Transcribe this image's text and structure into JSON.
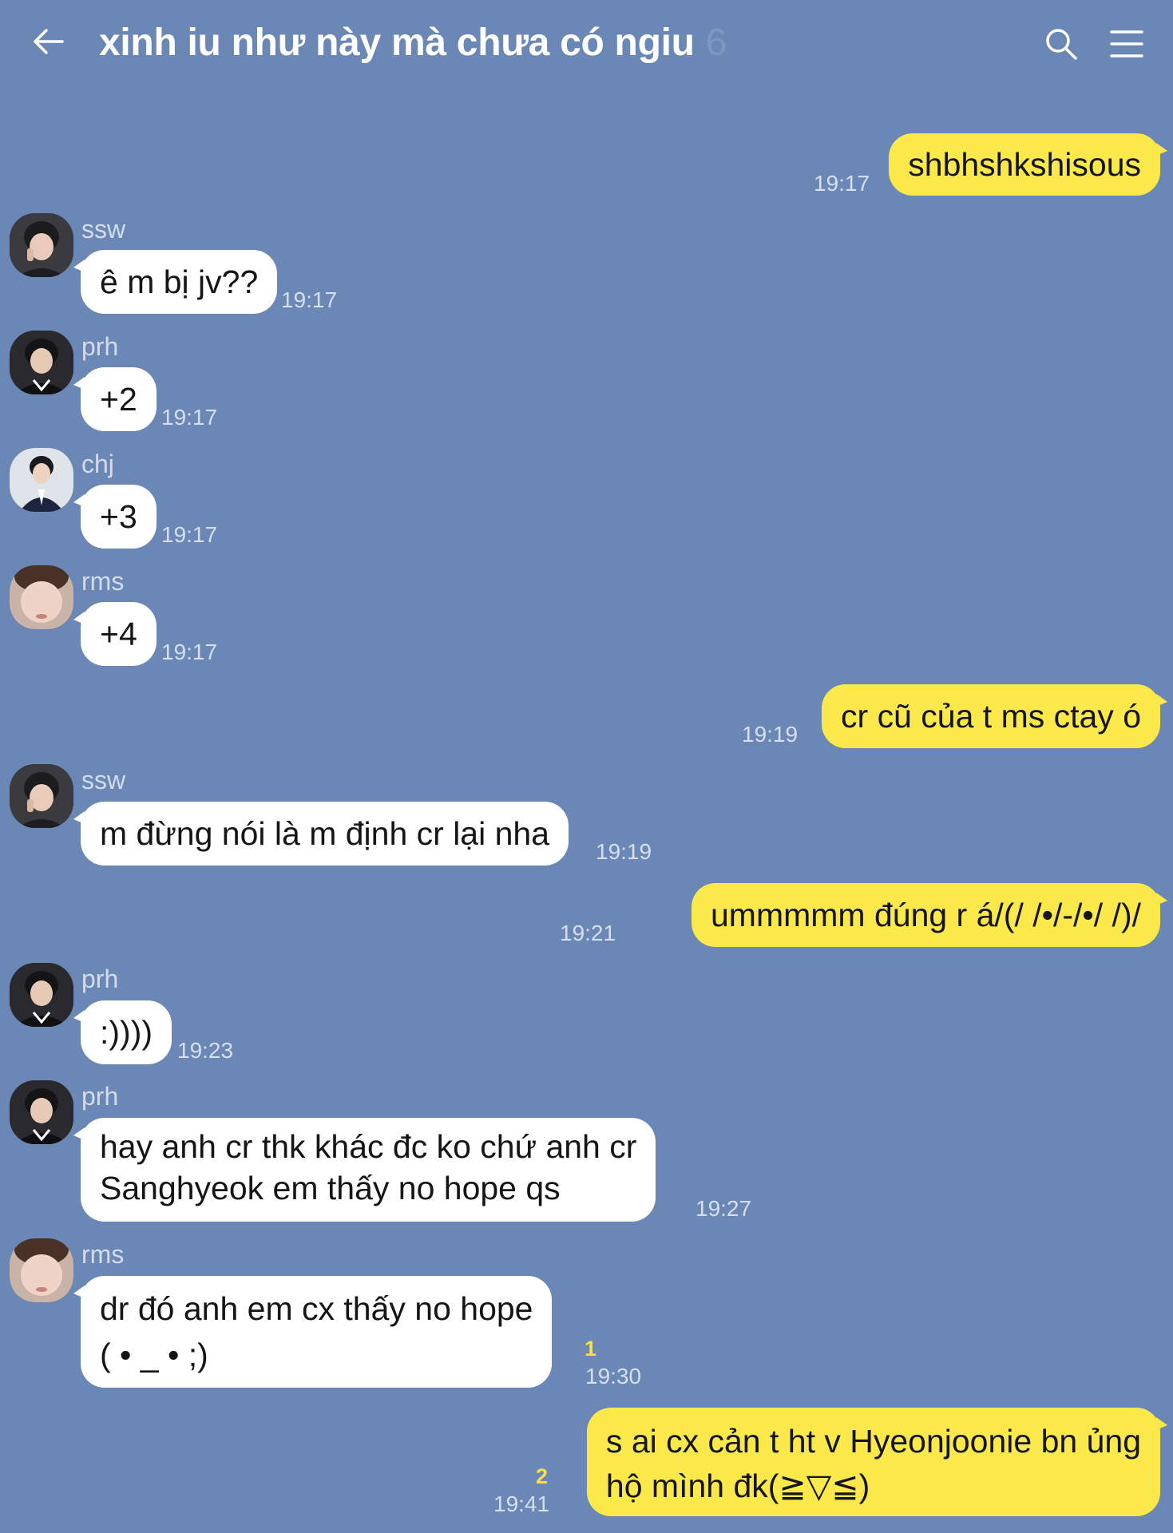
{
  "header": {
    "title": "xinh iu như này mà chưa có ngiu",
    "member_count": "6",
    "back_icon": "back-arrow-icon",
    "search_icon": "search-icon",
    "menu_icon": "menu-icon"
  },
  "colors": {
    "background": "#6b87b5",
    "outgoing_bubble": "#fbe94b",
    "incoming_bubble": "#ffffff",
    "unread_count": "#f7e13a"
  },
  "messages": [
    {
      "direction": "out",
      "text": "shbhshkshisous",
      "time": "19:17"
    },
    {
      "direction": "in",
      "sender": "ssw",
      "text": "ê m bị jv??",
      "time": "19:17"
    },
    {
      "direction": "in",
      "sender": "prh",
      "text": "+2",
      "time": "19:17"
    },
    {
      "direction": "in",
      "sender": "chj",
      "text": "+3",
      "time": "19:17"
    },
    {
      "direction": "in",
      "sender": "rms",
      "text": "+4",
      "time": "19:17"
    },
    {
      "direction": "out",
      "text": "cr cũ của t ms ctay ó",
      "time": "19:19"
    },
    {
      "direction": "in",
      "sender": "ssw",
      "text": "m đừng nói là m định cr lại nha",
      "time": "19:19"
    },
    {
      "direction": "out",
      "text": "ummmmm đúng r á/(/ /•/-/•/ /)/",
      "time": "19:21"
    },
    {
      "direction": "in",
      "sender": "prh",
      "text": ":))))",
      "time": "19:23"
    },
    {
      "direction": "in",
      "sender": "prh",
      "text_lines": [
        "hay anh cr thk khác đc ko chứ anh cr",
        "Sanghyeok em thấy no hope qs"
      ],
      "time": "19:27"
    },
    {
      "direction": "in",
      "sender": "rms",
      "text_lines": [
        "dr đó anh em cx thấy no hope",
        "( • _ • ;)"
      ],
      "time": "19:30",
      "unread": "1"
    },
    {
      "direction": "out",
      "text_lines": [
        "s ai cx cản t ht v Hyeonjoonie bn ủng",
        "hộ mình đk(≧▽≦)"
      ],
      "time": "19:41",
      "unread": "2"
    }
  ]
}
